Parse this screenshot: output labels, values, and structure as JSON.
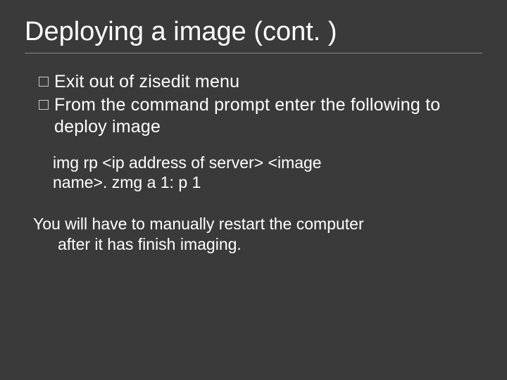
{
  "title": "Deploying a image (cont. )",
  "bullets": [
    "Exit out of zisedit menu",
    "From the command prompt enter the following to deploy image"
  ],
  "command": {
    "line1": "img rp <ip address of server> <image",
    "line2": "name>. zmg a 1: p 1"
  },
  "note": {
    "line1": "You will have to manually restart the computer",
    "line2": "after it has finish imaging."
  }
}
